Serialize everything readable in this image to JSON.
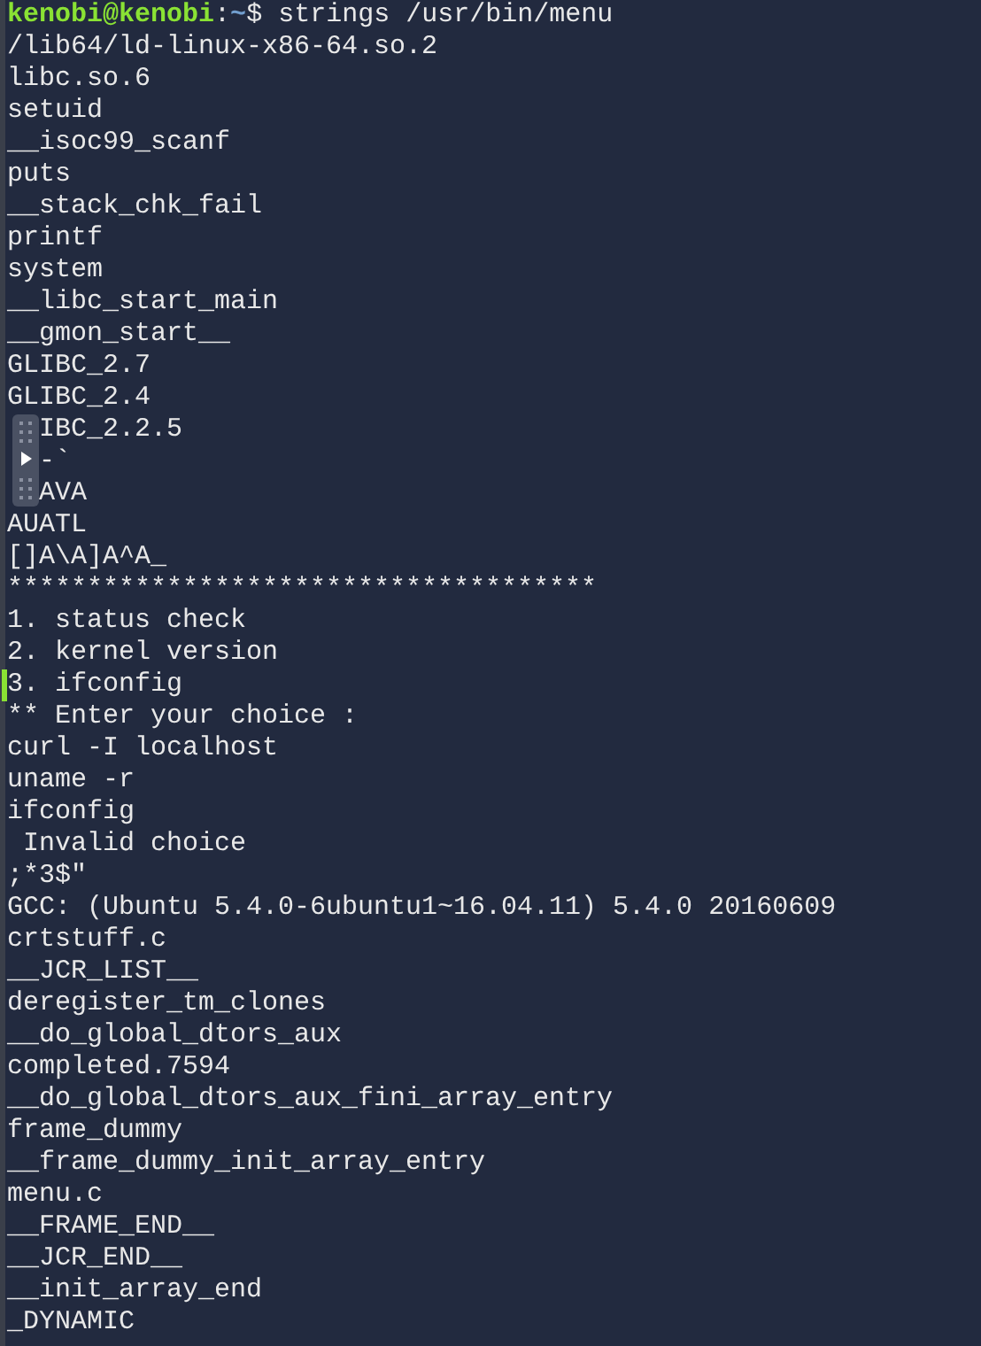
{
  "prompt": {
    "user_host": "kenobi@kenobi",
    "separator": ":",
    "path": "~",
    "symbol": "$",
    "command": "strings /usr/bin/menu"
  },
  "lines": [
    {
      "text": "/lib64/ld-linux-x86-64.so.2",
      "kind": "plain"
    },
    {
      "text": "libc.so.6",
      "kind": "plain"
    },
    {
      "text": "setuid",
      "kind": "plain"
    },
    {
      "text": "__isoc99_scanf",
      "kind": "plain"
    },
    {
      "text": "puts",
      "kind": "plain"
    },
    {
      "text": "__stack_chk_fail",
      "kind": "plain"
    },
    {
      "text": "printf",
      "kind": "plain"
    },
    {
      "text": "system",
      "kind": "plain"
    },
    {
      "text": "__libc_start_main",
      "kind": "plain"
    },
    {
      "text": "__gmon_start__",
      "kind": "plain"
    },
    {
      "text": "GLIBC_2.7",
      "kind": "plain"
    },
    {
      "text": "GLIBC_2.4",
      "kind": "plain"
    },
    {
      "text": "IBC_2.2.5",
      "kind": "partial"
    },
    {
      "text": "-`",
      "kind": "partial"
    },
    {
      "text": "AVA",
      "kind": "partial"
    },
    {
      "text": "AUATL",
      "kind": "plain"
    },
    {
      "text": "[]A\\A]A^A_",
      "kind": "plain"
    },
    {
      "text": "*************************************",
      "kind": "plain"
    },
    {
      "text": "1. status check",
      "kind": "plain"
    },
    {
      "text": "2. kernel version",
      "kind": "plain"
    },
    {
      "text": "3. ifconfig",
      "kind": "marked"
    },
    {
      "text": "** Enter your choice :",
      "kind": "plain"
    },
    {
      "text": "curl -I localhost",
      "kind": "plain"
    },
    {
      "text": "uname -r",
      "kind": "plain"
    },
    {
      "text": "ifconfig",
      "kind": "plain"
    },
    {
      "text": " Invalid choice",
      "kind": "plain"
    },
    {
      "text": ";*3$\"",
      "kind": "plain"
    },
    {
      "text": "GCC: (Ubuntu 5.4.0-6ubuntu1~16.04.11) 5.4.0 20160609",
      "kind": "plain"
    },
    {
      "text": "crtstuff.c",
      "kind": "plain"
    },
    {
      "text": "__JCR_LIST__",
      "kind": "plain"
    },
    {
      "text": "deregister_tm_clones",
      "kind": "plain"
    },
    {
      "text": "__do_global_dtors_aux",
      "kind": "plain"
    },
    {
      "text": "completed.7594",
      "kind": "plain"
    },
    {
      "text": "__do_global_dtors_aux_fini_array_entry",
      "kind": "plain"
    },
    {
      "text": "frame_dummy",
      "kind": "plain"
    },
    {
      "text": "__frame_dummy_init_array_entry",
      "kind": "plain"
    },
    {
      "text": "menu.c",
      "kind": "plain"
    },
    {
      "text": "__FRAME_END__",
      "kind": "plain"
    },
    {
      "text": "__JCR_END__",
      "kind": "plain"
    },
    {
      "text": "__init_array_end",
      "kind": "plain"
    },
    {
      "text": "_DYNAMIC",
      "kind": "plain"
    }
  ]
}
